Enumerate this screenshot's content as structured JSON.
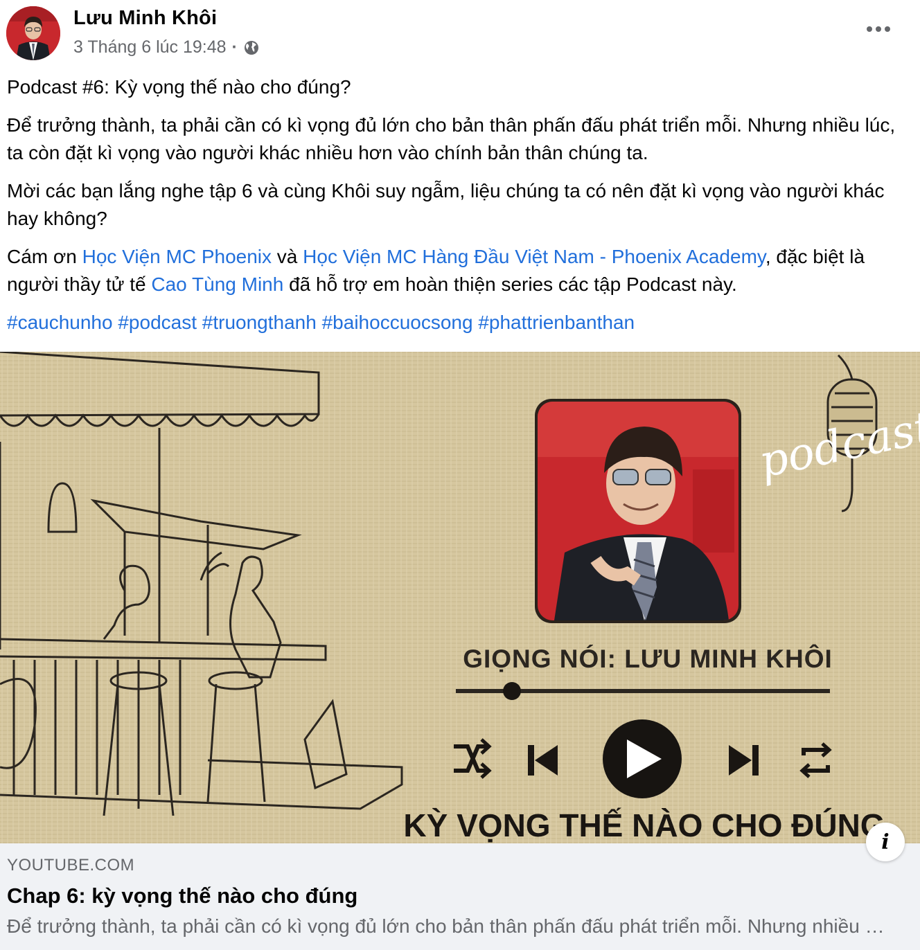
{
  "post": {
    "author": "Lưu Minh Khôi",
    "date": "3 Tháng 6 lúc 19:48",
    "separator": "·",
    "privacy_icon": "globe-icon",
    "more_icon": "more-dots-icon"
  },
  "content": {
    "title_line": "Podcast #6: Kỳ vọng thế nào cho đúng?",
    "para1": "Để trưởng thành, ta phải cần có kì vọng đủ lớn cho bản thân phấn đấu phát triển mỗi. Nhưng nhiều lúc, ta còn đặt kì vọng vào người khác nhiều hơn vào chính bản thân chúng ta.",
    "para2": "Mời các bạn lắng nghe tập 6 và cùng Khôi suy ngẫm, liệu chúng ta có nên đặt kì vọng vào người khác hay không?",
    "thanks_prefix": "Cám ơn ",
    "mention1": "Học Viện MC Phoenix",
    "thanks_and": " và ",
    "mention2": "Học Viện MC Hàng Đầu Việt Nam - Phoenix Academy",
    "thanks_mid": ", đặc biệt là người thầy tử tế ",
    "mention3": "Cao Tùng Minh",
    "thanks_suffix": " đã hỗ trợ em hoàn thiện series các tập Podcast này.",
    "hashtags": [
      "#cauchunho",
      "#podcast",
      "#truongthanh",
      "#baihoccuocsong",
      "#phattrienbanthan"
    ]
  },
  "thumbnail": {
    "podcast_word": "podcast",
    "voice_label": "GIỌNG NÓI: LƯU MINH KHÔI",
    "episode_title": "KỲ VỌNG THẾ NÀO CHO ĐÚNG",
    "progress": 0.15
  },
  "link_card": {
    "domain": "YOUTUBE.COM",
    "title": "Chap 6: kỳ vọng thế nào cho đúng",
    "description": "Để trưởng thành, ta phải cần có kì vọng đủ lớn cho bản thân phấn đấu phát triển mỗi. Nhưng nhiều lúc, ta còn đặt kì vọng vào người khác nhiều hơn vào chính bản thân chúng ta.",
    "info_label": "i"
  },
  "colors": {
    "link": "#216fdb",
    "secondary_text": "#65676b",
    "card_bg": "#f0f2f5",
    "thumb_bg": "#d6c79f",
    "thumb_red": "#c8282d"
  }
}
